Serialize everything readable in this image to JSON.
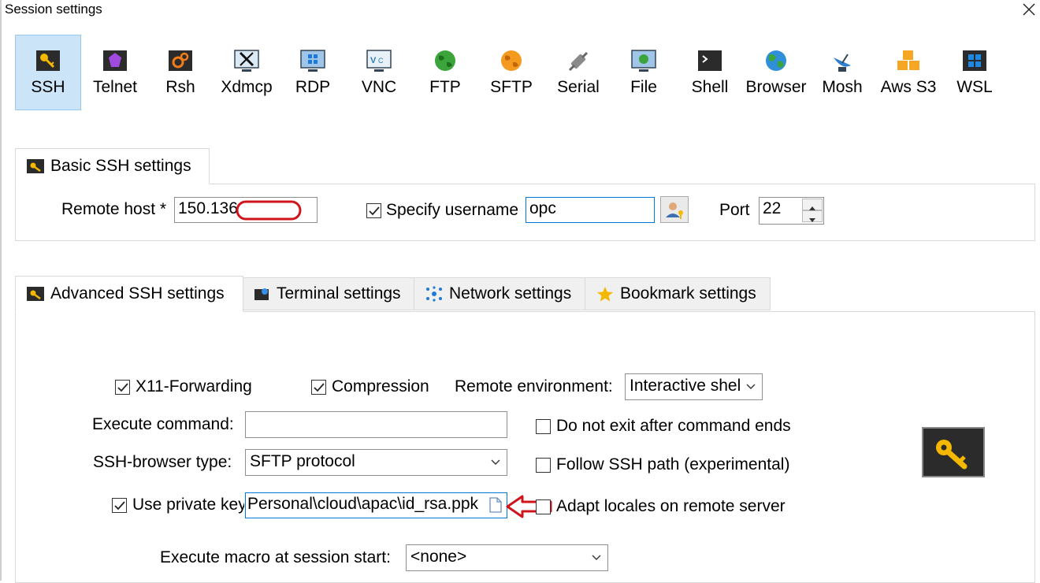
{
  "window": {
    "title": "Session settings",
    "close_glyph": "✕"
  },
  "session_types": [
    {
      "label": "SSH",
      "icon": "key-icon",
      "selected": true
    },
    {
      "label": "Telnet",
      "icon": "purple-gem-icon"
    },
    {
      "label": "Rsh",
      "icon": "gears-icon"
    },
    {
      "label": "Xdmcp",
      "icon": "x-window-icon"
    },
    {
      "label": "RDP",
      "icon": "windows-monitor-icon"
    },
    {
      "label": "VNC",
      "icon": "vnc-monitor-icon"
    },
    {
      "label": "FTP",
      "icon": "green-globe-icon"
    },
    {
      "label": "SFTP",
      "icon": "orange-globe-icon"
    },
    {
      "label": "Serial",
      "icon": "serial-plug-icon"
    },
    {
      "label": "File",
      "icon": "file-monitor-icon"
    },
    {
      "label": "Shell",
      "icon": "terminal-icon"
    },
    {
      "label": "Browser",
      "icon": "earth-globe-icon"
    },
    {
      "label": "Mosh",
      "icon": "satellite-icon"
    },
    {
      "label": "Aws S3",
      "icon": "cubes-icon"
    },
    {
      "label": "WSL",
      "icon": "windows-logo-icon"
    }
  ],
  "basic": {
    "tab_label": "Basic SSH settings",
    "remote_host_label": "Remote host *",
    "remote_host_value": "150.136",
    "specify_username_label": "Specify username",
    "specify_username_checked": true,
    "username_value": "opc",
    "port_label": "Port",
    "port_value": "22"
  },
  "tabs": [
    {
      "label": "Advanced SSH settings",
      "icon": "key-icon",
      "active": true
    },
    {
      "label": "Terminal settings",
      "icon": "terminal-settings-icon"
    },
    {
      "label": "Network settings",
      "icon": "network-icon"
    },
    {
      "label": "Bookmark settings",
      "icon": "star-icon"
    }
  ],
  "advanced": {
    "x11_label": "X11-Forwarding",
    "x11_checked": true,
    "compression_label": "Compression",
    "compression_checked": true,
    "remote_env_label": "Remote environment:",
    "remote_env_value": "Interactive shel",
    "execute_command_label": "Execute command:",
    "execute_command_value": "",
    "do_not_exit_label": "Do not exit after command ends",
    "do_not_exit_checked": false,
    "browser_type_label": "SSH-browser type:",
    "browser_type_value": "SFTP protocol",
    "follow_ssh_label": "Follow SSH path (experimental)",
    "follow_ssh_checked": false,
    "private_key_label": "Use private key",
    "private_key_checked": true,
    "private_key_value": "Personal\\cloud\\apac\\id_rsa.ppk",
    "adapt_locales_label": "Adapt locales on remote server",
    "adapt_locales_checked": false,
    "macro_label": "Execute macro at session start:",
    "macro_value": "<none>"
  },
  "colors": {
    "selected_bg": "#cce4f7",
    "annotation_red": "#d0141c",
    "focus_blue": "#0078d7",
    "key_gold": "#f5b800"
  }
}
